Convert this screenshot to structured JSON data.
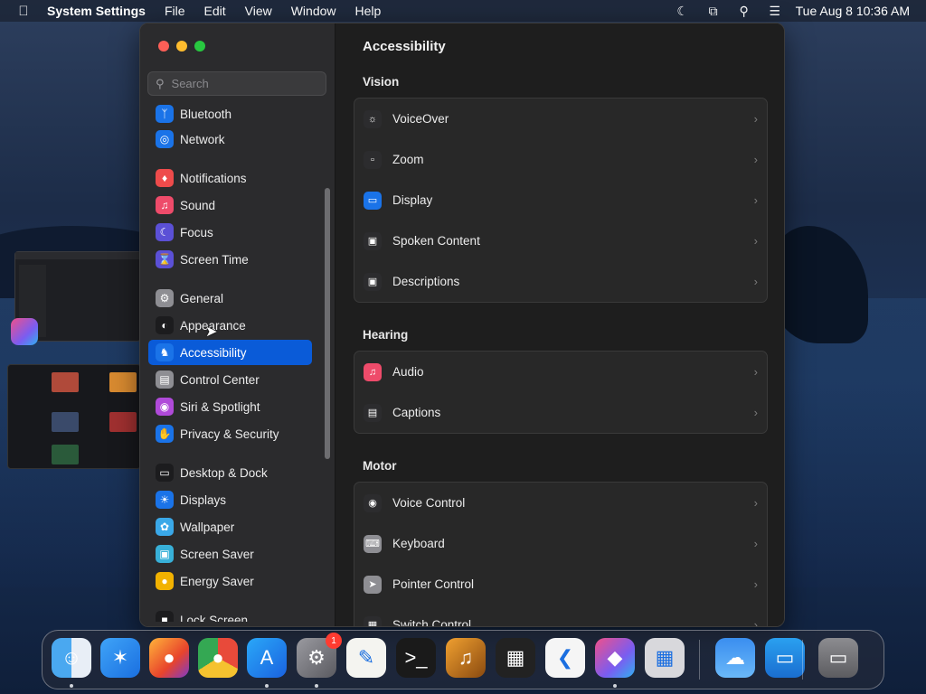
{
  "menubar": {
    "apple_icon": "apple-logo-icon",
    "app_name": "System Settings",
    "menus": [
      "File",
      "Edit",
      "View",
      "Window",
      "Help"
    ],
    "status_icons": [
      "moon-icon",
      "screen-mirroring-icon",
      "search-icon",
      "control-center-icon"
    ],
    "clock": "Tue Aug 8  10:36 AM"
  },
  "window": {
    "title": "Accessibility",
    "search_placeholder": "Search"
  },
  "sidebar": {
    "items": [
      {
        "label": "Bluetooth",
        "icon": "bluetooth-icon",
        "color": "#1a73e8"
      },
      {
        "label": "Network",
        "icon": "globe-icon",
        "color": "#1a73e8"
      },
      {
        "label": "Notifications",
        "icon": "bell-icon",
        "color": "#ee4b4b"
      },
      {
        "label": "Sound",
        "icon": "speaker-icon",
        "color": "#ee4b6a"
      },
      {
        "label": "Focus",
        "icon": "moon-icon",
        "color": "#5b50d6"
      },
      {
        "label": "Screen Time",
        "icon": "hourglass-icon",
        "color": "#5b50d6"
      },
      {
        "label": "General",
        "icon": "gear-icon",
        "color": "#8e8e93"
      },
      {
        "label": "Appearance",
        "icon": "appearance-icon",
        "color": "#1c1c1e"
      },
      {
        "label": "Accessibility",
        "icon": "accessibility-icon",
        "color": "#1a73e8"
      },
      {
        "label": "Control Center",
        "icon": "toggles-icon",
        "color": "#8e8e93"
      },
      {
        "label": "Siri & Spotlight",
        "icon": "siri-icon",
        "color": "#b04ad9"
      },
      {
        "label": "Privacy & Security",
        "icon": "hand-icon",
        "color": "#1a73e8"
      },
      {
        "label": "Desktop & Dock",
        "icon": "desktop-icon",
        "color": "#1c1c1e"
      },
      {
        "label": "Displays",
        "icon": "sun-icon",
        "color": "#1a73e8"
      },
      {
        "label": "Wallpaper",
        "icon": "flower-icon",
        "color": "#3aa8e8"
      },
      {
        "label": "Screen Saver",
        "icon": "screen-saver-icon",
        "color": "#38b0d8"
      },
      {
        "label": "Energy Saver",
        "icon": "lightbulb-icon",
        "color": "#f2b200"
      },
      {
        "label": "Lock Screen",
        "icon": "lock-icon",
        "color": "#1c1c1e"
      }
    ],
    "selected": "Accessibility"
  },
  "content": {
    "sections": [
      {
        "title": "Vision",
        "rows": [
          {
            "label": "VoiceOver",
            "icon": "voiceover-icon"
          },
          {
            "label": "Zoom",
            "icon": "zoom-icon"
          },
          {
            "label": "Display",
            "icon": "display-icon"
          },
          {
            "label": "Spoken Content",
            "icon": "spoken-content-icon"
          },
          {
            "label": "Descriptions",
            "icon": "descriptions-icon"
          }
        ]
      },
      {
        "title": "Hearing",
        "rows": [
          {
            "label": "Audio",
            "icon": "audio-icon"
          },
          {
            "label": "Captions",
            "icon": "captions-icon"
          }
        ]
      },
      {
        "title": "Motor",
        "rows": [
          {
            "label": "Voice Control",
            "icon": "voice-control-icon"
          },
          {
            "label": "Keyboard",
            "icon": "keyboard-icon"
          },
          {
            "label": "Pointer Control",
            "icon": "pointer-icon"
          },
          {
            "label": "Switch Control",
            "icon": "switch-control-icon"
          }
        ]
      }
    ]
  },
  "dock": {
    "apps": [
      {
        "name": "Finder",
        "icon": "finder-icon",
        "running": true
      },
      {
        "name": "Safari",
        "icon": "safari-icon",
        "running": false
      },
      {
        "name": "Firefox",
        "icon": "firefox-icon",
        "running": false
      },
      {
        "name": "Chrome",
        "icon": "chrome-icon",
        "running": false
      },
      {
        "name": "App Store",
        "icon": "app-store-icon",
        "running": true
      },
      {
        "name": "System Settings",
        "icon": "system-settings-icon",
        "running": true,
        "badge": "1"
      },
      {
        "name": "TextEdit",
        "icon": "textedit-icon",
        "running": false
      },
      {
        "name": "Terminal",
        "icon": "terminal-icon",
        "running": false
      },
      {
        "name": "GarageBand",
        "icon": "garageband-icon",
        "running": false
      },
      {
        "name": "Activity",
        "icon": "activity-icon",
        "running": false
      },
      {
        "name": "VS Code",
        "icon": "vscode-icon",
        "running": false
      },
      {
        "name": "Shortcuts",
        "icon": "shortcuts-icon",
        "running": true
      },
      {
        "name": "Launchpad",
        "icon": "launchpad-icon",
        "running": false
      },
      {
        "name": "Weather",
        "icon": "weather-icon",
        "running": false
      },
      {
        "name": "Keynote",
        "icon": "keynote-icon",
        "running": false
      },
      {
        "name": "Trash",
        "icon": "trash-icon",
        "running": false
      }
    ]
  }
}
